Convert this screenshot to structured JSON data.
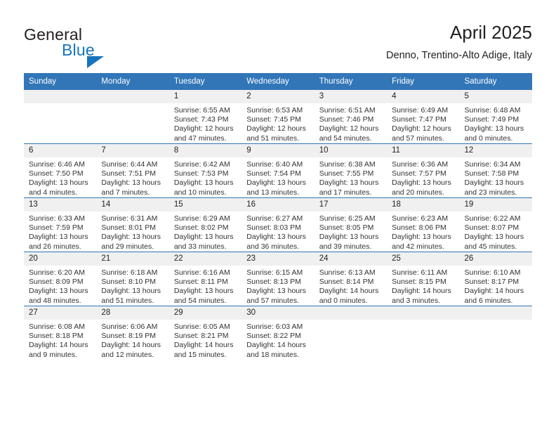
{
  "brand": {
    "name_top": "General",
    "name_bottom": "Blue",
    "mark": "triangle-flag-icon",
    "color": "#1574bd"
  },
  "header": {
    "title": "April 2025",
    "subtitle": "Denno, Trentino-Alto Adige, Italy"
  },
  "theme": {
    "header_bg": "#3276b8",
    "daynum_bg": "#f0f0f0",
    "row_rule": "#3276b8",
    "text": "#222222"
  },
  "calendar": {
    "weekday_headers": [
      "Sunday",
      "Monday",
      "Tuesday",
      "Wednesday",
      "Thursday",
      "Friday",
      "Saturday"
    ],
    "weeks": [
      [
        {
          "day": ""
        },
        {
          "day": ""
        },
        {
          "day": "1",
          "sunrise": "Sunrise: 6:55 AM",
          "sunset": "Sunset: 7:43 PM",
          "daylight_1": "Daylight: 12 hours",
          "daylight_2": "and 47 minutes."
        },
        {
          "day": "2",
          "sunrise": "Sunrise: 6:53 AM",
          "sunset": "Sunset: 7:45 PM",
          "daylight_1": "Daylight: 12 hours",
          "daylight_2": "and 51 minutes."
        },
        {
          "day": "3",
          "sunrise": "Sunrise: 6:51 AM",
          "sunset": "Sunset: 7:46 PM",
          "daylight_1": "Daylight: 12 hours",
          "daylight_2": "and 54 minutes."
        },
        {
          "day": "4",
          "sunrise": "Sunrise: 6:49 AM",
          "sunset": "Sunset: 7:47 PM",
          "daylight_1": "Daylight: 12 hours",
          "daylight_2": "and 57 minutes."
        },
        {
          "day": "5",
          "sunrise": "Sunrise: 6:48 AM",
          "sunset": "Sunset: 7:49 PM",
          "daylight_1": "Daylight: 13 hours",
          "daylight_2": "and 0 minutes."
        }
      ],
      [
        {
          "day": "6",
          "sunrise": "Sunrise: 6:46 AM",
          "sunset": "Sunset: 7:50 PM",
          "daylight_1": "Daylight: 13 hours",
          "daylight_2": "and 4 minutes."
        },
        {
          "day": "7",
          "sunrise": "Sunrise: 6:44 AM",
          "sunset": "Sunset: 7:51 PM",
          "daylight_1": "Daylight: 13 hours",
          "daylight_2": "and 7 minutes."
        },
        {
          "day": "8",
          "sunrise": "Sunrise: 6:42 AM",
          "sunset": "Sunset: 7:53 PM",
          "daylight_1": "Daylight: 13 hours",
          "daylight_2": "and 10 minutes."
        },
        {
          "day": "9",
          "sunrise": "Sunrise: 6:40 AM",
          "sunset": "Sunset: 7:54 PM",
          "daylight_1": "Daylight: 13 hours",
          "daylight_2": "and 13 minutes."
        },
        {
          "day": "10",
          "sunrise": "Sunrise: 6:38 AM",
          "sunset": "Sunset: 7:55 PM",
          "daylight_1": "Daylight: 13 hours",
          "daylight_2": "and 17 minutes."
        },
        {
          "day": "11",
          "sunrise": "Sunrise: 6:36 AM",
          "sunset": "Sunset: 7:57 PM",
          "daylight_1": "Daylight: 13 hours",
          "daylight_2": "and 20 minutes."
        },
        {
          "day": "12",
          "sunrise": "Sunrise: 6:34 AM",
          "sunset": "Sunset: 7:58 PM",
          "daylight_1": "Daylight: 13 hours",
          "daylight_2": "and 23 minutes."
        }
      ],
      [
        {
          "day": "13",
          "sunrise": "Sunrise: 6:33 AM",
          "sunset": "Sunset: 7:59 PM",
          "daylight_1": "Daylight: 13 hours",
          "daylight_2": "and 26 minutes."
        },
        {
          "day": "14",
          "sunrise": "Sunrise: 6:31 AM",
          "sunset": "Sunset: 8:01 PM",
          "daylight_1": "Daylight: 13 hours",
          "daylight_2": "and 29 minutes."
        },
        {
          "day": "15",
          "sunrise": "Sunrise: 6:29 AM",
          "sunset": "Sunset: 8:02 PM",
          "daylight_1": "Daylight: 13 hours",
          "daylight_2": "and 33 minutes."
        },
        {
          "day": "16",
          "sunrise": "Sunrise: 6:27 AM",
          "sunset": "Sunset: 8:03 PM",
          "daylight_1": "Daylight: 13 hours",
          "daylight_2": "and 36 minutes."
        },
        {
          "day": "17",
          "sunrise": "Sunrise: 6:25 AM",
          "sunset": "Sunset: 8:05 PM",
          "daylight_1": "Daylight: 13 hours",
          "daylight_2": "and 39 minutes."
        },
        {
          "day": "18",
          "sunrise": "Sunrise: 6:23 AM",
          "sunset": "Sunset: 8:06 PM",
          "daylight_1": "Daylight: 13 hours",
          "daylight_2": "and 42 minutes."
        },
        {
          "day": "19",
          "sunrise": "Sunrise: 6:22 AM",
          "sunset": "Sunset: 8:07 PM",
          "daylight_1": "Daylight: 13 hours",
          "daylight_2": "and 45 minutes."
        }
      ],
      [
        {
          "day": "20",
          "sunrise": "Sunrise: 6:20 AM",
          "sunset": "Sunset: 8:09 PM",
          "daylight_1": "Daylight: 13 hours",
          "daylight_2": "and 48 minutes."
        },
        {
          "day": "21",
          "sunrise": "Sunrise: 6:18 AM",
          "sunset": "Sunset: 8:10 PM",
          "daylight_1": "Daylight: 13 hours",
          "daylight_2": "and 51 minutes."
        },
        {
          "day": "22",
          "sunrise": "Sunrise: 6:16 AM",
          "sunset": "Sunset: 8:11 PM",
          "daylight_1": "Daylight: 13 hours",
          "daylight_2": "and 54 minutes."
        },
        {
          "day": "23",
          "sunrise": "Sunrise: 6:15 AM",
          "sunset": "Sunset: 8:13 PM",
          "daylight_1": "Daylight: 13 hours",
          "daylight_2": "and 57 minutes."
        },
        {
          "day": "24",
          "sunrise": "Sunrise: 6:13 AM",
          "sunset": "Sunset: 8:14 PM",
          "daylight_1": "Daylight: 14 hours",
          "daylight_2": "and 0 minutes."
        },
        {
          "day": "25",
          "sunrise": "Sunrise: 6:11 AM",
          "sunset": "Sunset: 8:15 PM",
          "daylight_1": "Daylight: 14 hours",
          "daylight_2": "and 3 minutes."
        },
        {
          "day": "26",
          "sunrise": "Sunrise: 6:10 AM",
          "sunset": "Sunset: 8:17 PM",
          "daylight_1": "Daylight: 14 hours",
          "daylight_2": "and 6 minutes."
        }
      ],
      [
        {
          "day": "27",
          "sunrise": "Sunrise: 6:08 AM",
          "sunset": "Sunset: 8:18 PM",
          "daylight_1": "Daylight: 14 hours",
          "daylight_2": "and 9 minutes."
        },
        {
          "day": "28",
          "sunrise": "Sunrise: 6:06 AM",
          "sunset": "Sunset: 8:19 PM",
          "daylight_1": "Daylight: 14 hours",
          "daylight_2": "and 12 minutes."
        },
        {
          "day": "29",
          "sunrise": "Sunrise: 6:05 AM",
          "sunset": "Sunset: 8:21 PM",
          "daylight_1": "Daylight: 14 hours",
          "daylight_2": "and 15 minutes."
        },
        {
          "day": "30",
          "sunrise": "Sunrise: 6:03 AM",
          "sunset": "Sunset: 8:22 PM",
          "daylight_1": "Daylight: 14 hours",
          "daylight_2": "and 18 minutes."
        },
        {
          "day": ""
        },
        {
          "day": ""
        },
        {
          "day": ""
        }
      ]
    ]
  }
}
